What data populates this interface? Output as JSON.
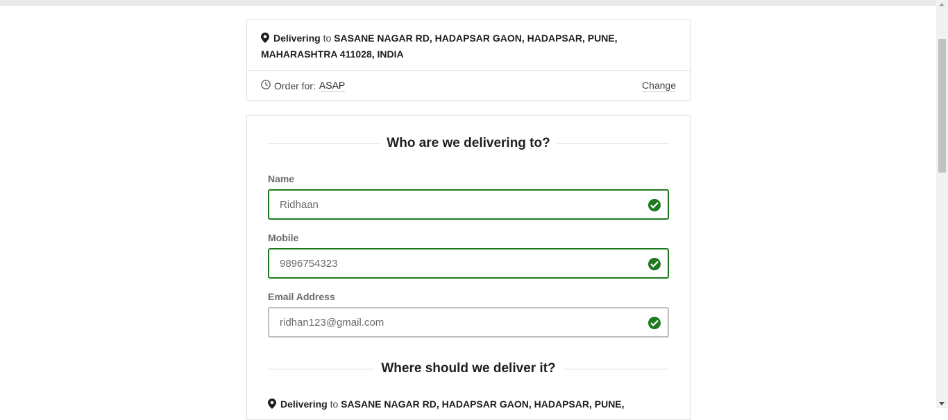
{
  "delivery": {
    "label": "Delivering",
    "to": "to",
    "address": "SASANE NAGAR RD, HADAPSAR GAON, HADAPSAR, PUNE, MAHARASHTRA 411028, INDIA"
  },
  "order": {
    "label": "Order for:",
    "value": "ASAP",
    "change_label": "Change"
  },
  "who_section": {
    "title": "Who are we delivering to?"
  },
  "fields": {
    "name": {
      "label": "Name",
      "value": "Ridhaan"
    },
    "mobile": {
      "label": "Mobile",
      "value": "9896754323"
    },
    "email": {
      "label": "Email Address",
      "value": "ridhan123@gmail.com"
    }
  },
  "where_section": {
    "title": "Where should we deliver it?"
  },
  "delivery2": {
    "label": "Delivering",
    "to": "to",
    "address": "SASANE NAGAR RD, HADAPSAR GAON, HADAPSAR, PUNE,"
  },
  "colors": {
    "valid_green": "#1f7a1f",
    "border_grey": "#bdbdbd"
  },
  "icons": [
    "map-pin-icon",
    "clock-icon",
    "check-circle-icon"
  ]
}
